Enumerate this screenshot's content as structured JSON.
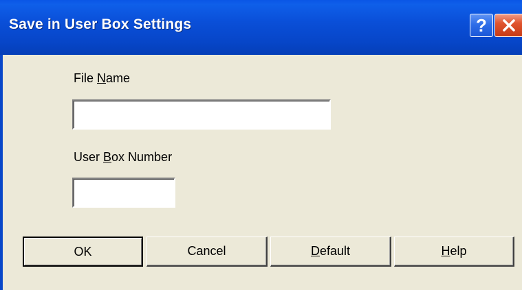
{
  "window": {
    "title": "Save in User Box Settings",
    "help_glyph": "?",
    "close_icon": "close-icon"
  },
  "form": {
    "file_name": {
      "label_before": "File ",
      "label_mnemonic": "N",
      "label_after": "ame",
      "value": ""
    },
    "user_box_number": {
      "label_before": "User ",
      "label_mnemonic": "B",
      "label_after": "ox Number",
      "value": ""
    }
  },
  "buttons": {
    "ok": {
      "label": "OK"
    },
    "cancel": {
      "label": "Cancel"
    },
    "default": {
      "mnemonic": "D",
      "rest": "efault"
    },
    "help": {
      "mnemonic": "H",
      "rest": "elp"
    }
  },
  "colors": {
    "titlebar": "#0a4fd8",
    "dialog_bg": "#ece9d8",
    "close_red": "#e0552f"
  }
}
